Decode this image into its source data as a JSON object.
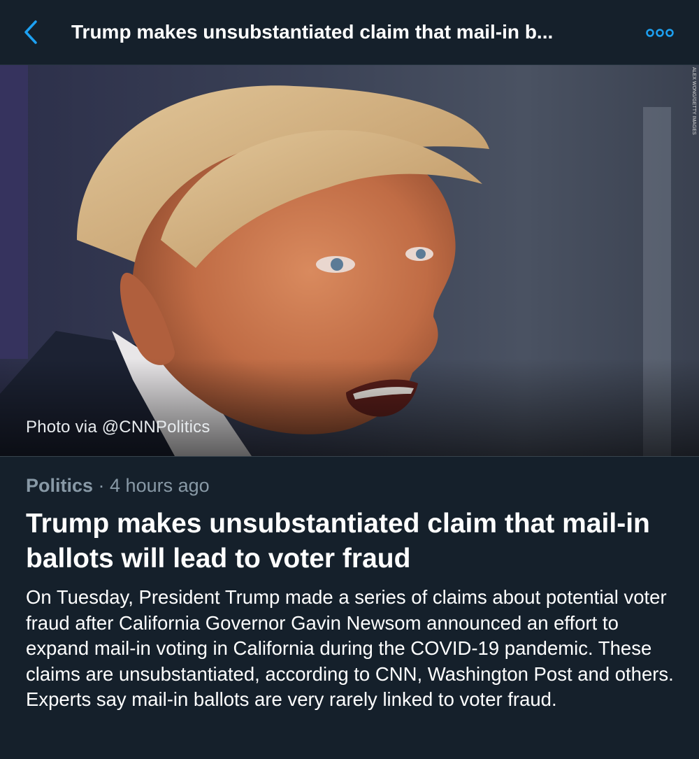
{
  "header": {
    "title": "Trump makes unsubstantiated claim that mail-in b...",
    "back_icon": "chevron-left-icon",
    "more_icon": "more-options-icon"
  },
  "photo": {
    "credit": "Photo via @CNNPolitics",
    "watermark": "ALEX WONG/GETTY IMAGES"
  },
  "article": {
    "category": "Politics",
    "separator": " · ",
    "time": "4 hours ago",
    "headline": "Trump makes unsubstantiated claim that mail-in ballots will lead to voter fraud",
    "summary": "On Tuesday, President Trump made a series of claims about potential voter fraud after California Governor Gavin Newsom announced an effort to expand mail-in voting in California during the COVID-19 pandemic. These claims are unsubstantiated, according to CNN, Washington Post and others. Experts say mail-in ballots are very rarely linked to voter fraud."
  },
  "colors": {
    "background": "#15202b",
    "accent": "#1da1f2",
    "muted_text": "#8899a6"
  }
}
